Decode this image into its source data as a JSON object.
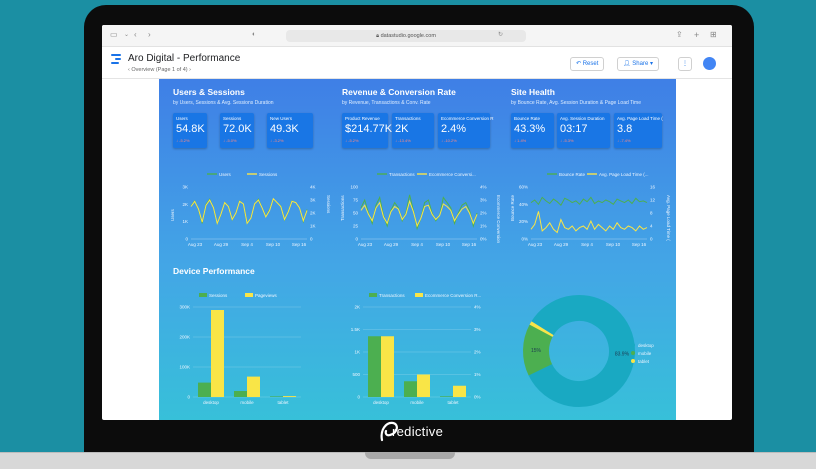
{
  "browser": {
    "url": "datastudio.google.com"
  },
  "app": {
    "title": "Aro Digital - Performance",
    "page_nav": "Overview (Page 1 of 4)",
    "reset_label": "Reset",
    "share_label": "Share"
  },
  "sections": {
    "users": {
      "title": "Users & Sessions",
      "subtitle": "by Users, Sessions & Avg. Sessions Duration"
    },
    "revenue": {
      "title": "Revenue & Conversion Rate",
      "subtitle": "by Revenue, Transactions & Conv. Rate"
    },
    "health": {
      "title": "Site Health",
      "subtitle": "by Bounce Rate, Avg. Session Duration & Page Load Time"
    },
    "device": {
      "title": "Device Performance"
    }
  },
  "kpis": [
    {
      "label": "Users",
      "value": "54.8K",
      "delta": "↓ -5.2%"
    },
    {
      "label": "Sessions",
      "value": "72.0K",
      "delta": "↓ -5.0%"
    },
    {
      "label": "New Users",
      "value": "49.3K",
      "delta": "↓ -3.2%"
    },
    {
      "label": "Product Revenue",
      "value": "$214.77K",
      "delta": "↓ -5.2%"
    },
    {
      "label": "Transactions",
      "value": "2K",
      "delta": "↓ -13.4%"
    },
    {
      "label": "Ecommerce Conversion R",
      "value": "2.4%",
      "delta": "↓ -10.2%"
    },
    {
      "label": "Bounce Rate",
      "value": "43.3%",
      "delta": "↓ 1.4%"
    },
    {
      "label": "Avg. Session Duration",
      "value": "03:17",
      "delta": "↓ -5.3%"
    },
    {
      "label": "Avg. Page Load Time (",
      "value": "3.8",
      "delta": "↓ -7.4%"
    }
  ],
  "brand": {
    "name": "redictive"
  },
  "colors": {
    "green": "#4caf50",
    "yellow": "#f9e547",
    "teal": "#19a9c2"
  },
  "chart_data": [
    {
      "type": "line",
      "x": [
        "Aug 23",
        "Aug 29",
        "Sep 4",
        "Sep 10",
        "Sep 16"
      ],
      "yticks_left": [
        "3K",
        "2K",
        "1K",
        "0"
      ],
      "yticks_right": [
        "4K",
        "3K",
        "2K",
        "1K",
        "0"
      ],
      "ylabel": "Users",
      "ylabel_right": "Sessions",
      "series": [
        {
          "name": "Users",
          "values": [
            1900,
            2200,
            1700,
            900,
            2000,
            2300,
            1800,
            900,
            1400,
            2100,
            1900,
            1100,
            1500,
            2200,
            2000,
            900,
            1200,
            2000,
            2300,
            1800,
            1300,
            1700,
            2300,
            2100,
            1900,
            1100,
            1600,
            2200,
            2100,
            1800,
            1000,
            1700
          ]
        },
        {
          "name": "Sessions",
          "values": [
            2500,
            2900,
            2300,
            1300,
            2600,
            3000,
            2400,
            1200,
            1900,
            2800,
            2500,
            1500,
            2000,
            2900,
            2700,
            1200,
            1600,
            2700,
            3000,
            2400,
            1700,
            2200,
            3100,
            2800,
            2500,
            1500,
            2100,
            2900,
            2800,
            2400,
            1400,
            2200
          ]
        }
      ]
    },
    {
      "type": "line",
      "x": [
        "Aug 23",
        "Aug 29",
        "Sep 4",
        "Sep 10",
        "Sep 16"
      ],
      "yticks_left": [
        "100",
        "75",
        "50",
        "25",
        "0"
      ],
      "yticks_right": [
        "4%",
        "3%",
        "2%",
        "1%",
        "0%"
      ],
      "ylabel": "Transactions",
      "ylabel_right": "Ecommerce Conversion",
      "series": [
        {
          "name": "Transactions",
          "values": [
            60,
            75,
            50,
            30,
            65,
            80,
            45,
            25,
            55,
            70,
            60,
            35,
            50,
            85,
            55,
            20,
            40,
            70,
            75,
            50,
            35,
            45,
            80,
            70,
            60,
            30,
            50,
            65,
            70,
            55,
            25,
            50
          ]
        },
        {
          "name": "Ecommerce Conversi...",
          "values": [
            2.2,
            2.6,
            1.9,
            1.4,
            2.4,
            2.8,
            1.7,
            1.2,
            2.1,
            2.5,
            2.3,
            1.5,
            1.9,
            2.9,
            2.1,
            1.0,
            1.6,
            2.5,
            2.6,
            1.9,
            1.5,
            1.8,
            2.7,
            2.5,
            2.2,
            1.4,
            1.9,
            2.3,
            2.5,
            2.0,
            1.2,
            1.9
          ]
        }
      ]
    },
    {
      "type": "line",
      "x": [
        "Aug 23",
        "Aug 29",
        "Sep 4",
        "Sep 10",
        "Sep 16"
      ],
      "yticks_left": [
        "60%",
        "40%",
        "20%",
        "0%"
      ],
      "yticks_right": [
        "16",
        "12",
        "8",
        "4",
        "0"
      ],
      "ylabel": "Bounce Rate",
      "ylabel_right": "Avg. Page Load Time (",
      "series": [
        {
          "name": "Bounce Rate",
          "values": [
            42,
            45,
            40,
            48,
            44,
            41,
            46,
            43,
            39,
            47,
            45,
            42,
            44,
            40,
            46,
            43,
            48,
            41,
            44,
            42,
            45,
            43,
            40,
            46,
            44,
            42,
            45,
            41,
            47,
            43,
            44,
            42
          ]
        },
        {
          "name": "Avg. Page Load Time (...",
          "values": [
            3.0,
            4.5,
            8.5,
            2.5,
            3.5,
            5.0,
            3.0,
            2.0,
            6.0,
            3.5,
            3.0,
            4.0,
            2.5,
            3.5,
            4.0,
            3.0,
            5.5,
            3.0,
            4.5,
            3.5,
            2.5,
            4.0,
            3.0,
            5.0,
            3.5,
            3.0,
            4.0,
            3.5,
            2.5,
            4.0,
            3.0,
            3.5
          ]
        }
      ]
    },
    {
      "type": "bar",
      "categories": [
        "desktop",
        "mobile",
        "tablet"
      ],
      "yticks": [
        "300K",
        "200K",
        "100K",
        "0"
      ],
      "series": [
        {
          "name": "Sessions",
          "values": [
            48000,
            20000,
            2000
          ]
        },
        {
          "name": "Pageviews",
          "values": [
            290000,
            68000,
            3000
          ]
        }
      ]
    },
    {
      "type": "bar",
      "categories": [
        "desktop",
        "mobile",
        "tablet"
      ],
      "yticks_left": [
        "2K",
        "1.5K",
        "1K",
        "500",
        "0"
      ],
      "yticks_right": [
        "4%",
        "3%",
        "2%",
        "1%",
        "0%"
      ],
      "series": [
        {
          "name": "Transactions",
          "values": [
            1350,
            350,
            15
          ]
        },
        {
          "name": "Ecommerce Conversion R...",
          "values": [
            2.7,
            1.0,
            0.5
          ]
        }
      ]
    },
    {
      "type": "pie",
      "series": [
        {
          "name": "desktop",
          "value": 83.9,
          "label": "83.9%"
        },
        {
          "name": "mobile",
          "value": 15.0,
          "label": "15%"
        },
        {
          "name": "tablet",
          "value": 1.1,
          "label": ""
        }
      ]
    }
  ]
}
